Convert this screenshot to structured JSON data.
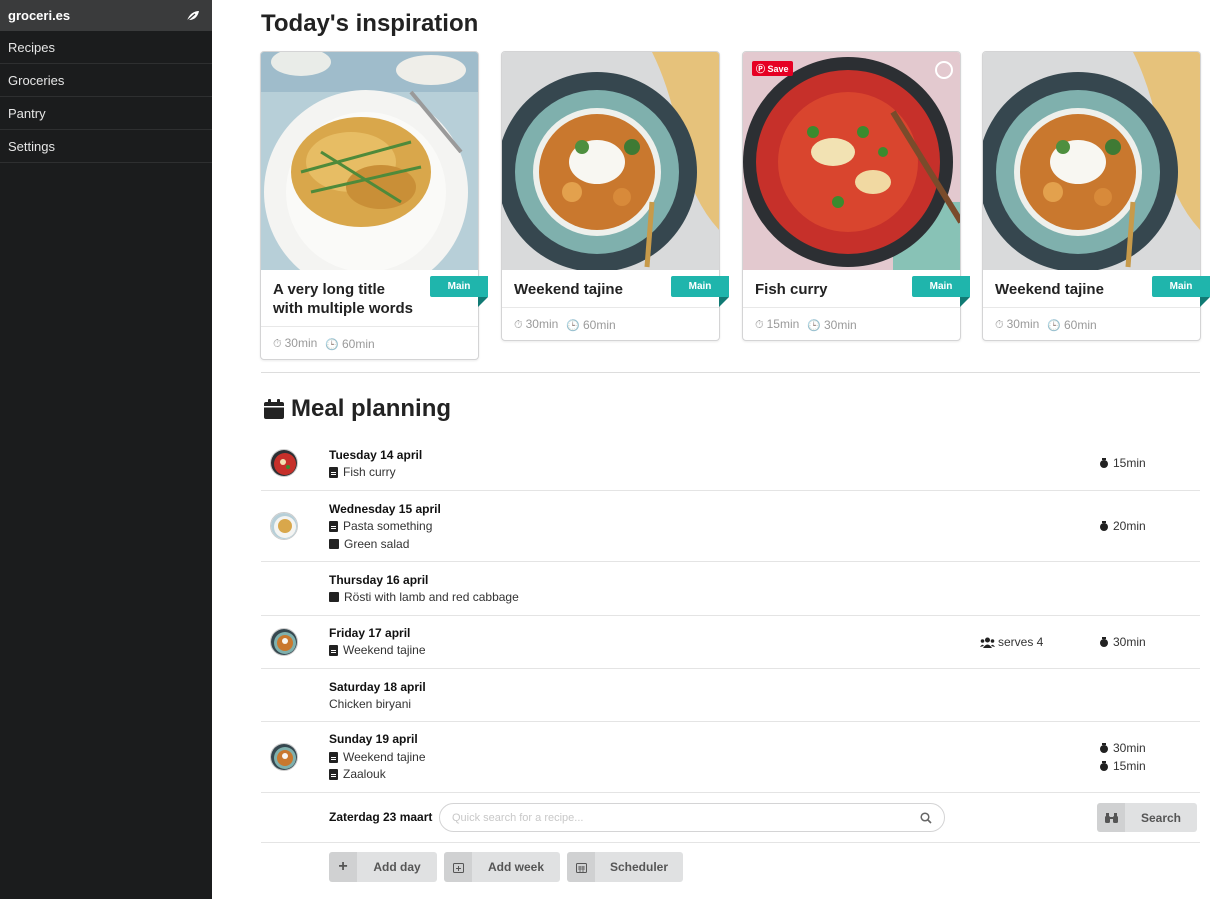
{
  "sidebar": {
    "brand": "groceri.es",
    "items": [
      {
        "label": "Recipes"
      },
      {
        "label": "Groceries"
      },
      {
        "label": "Pantry"
      },
      {
        "label": "Settings"
      }
    ]
  },
  "inspiration": {
    "title": "Today's inspiration",
    "cards": [
      {
        "title": "A very long title with multiple words",
        "tag": "Main",
        "prep": "30min",
        "total": "60min"
      },
      {
        "title": "Weekend tajine",
        "tag": "Main",
        "prep": "30min",
        "total": "60min"
      },
      {
        "title": "Fish curry",
        "tag": "Main",
        "prep": "15min",
        "total": "30min",
        "save_label": "Save"
      },
      {
        "title": "Weekend tajine",
        "tag": "Main",
        "prep": "30min",
        "total": "60min"
      }
    ]
  },
  "meal_planning": {
    "title": "Meal planning",
    "days": [
      {
        "day": "Tuesday 14 april",
        "dishes": [
          "Fish curry"
        ],
        "times": [
          "15min"
        ]
      },
      {
        "day": "Wednesday 15 april",
        "dishes": [
          "Pasta something",
          "Green salad"
        ],
        "times": [
          "20min"
        ]
      },
      {
        "day": "Thursday 16 april",
        "dishes": [
          "Rösti with lamb and red cabbage"
        ],
        "times": []
      },
      {
        "day": "Friday 17 april",
        "dishes": [
          "Weekend tajine"
        ],
        "serves": "serves 4",
        "times": [
          "30min"
        ]
      },
      {
        "day": "Saturday 18 april",
        "dishes": [
          "Chicken biryani"
        ],
        "times": []
      },
      {
        "day": "Sunday 19 april",
        "dishes": [
          "Weekend tajine",
          "Zaalouk"
        ],
        "times": [
          "30min",
          "15min"
        ]
      }
    ],
    "new_day": "Zaterdag 23 maart",
    "search_placeholder": "Quick search for a recipe...",
    "search_button": "Search",
    "buttons": {
      "add_day": "Add day",
      "add_week": "Add week",
      "scheduler": "Scheduler"
    }
  },
  "colors": {
    "accent": "#1fb5ac",
    "sidebar": "#1b1c1d",
    "save": "#e60023"
  }
}
